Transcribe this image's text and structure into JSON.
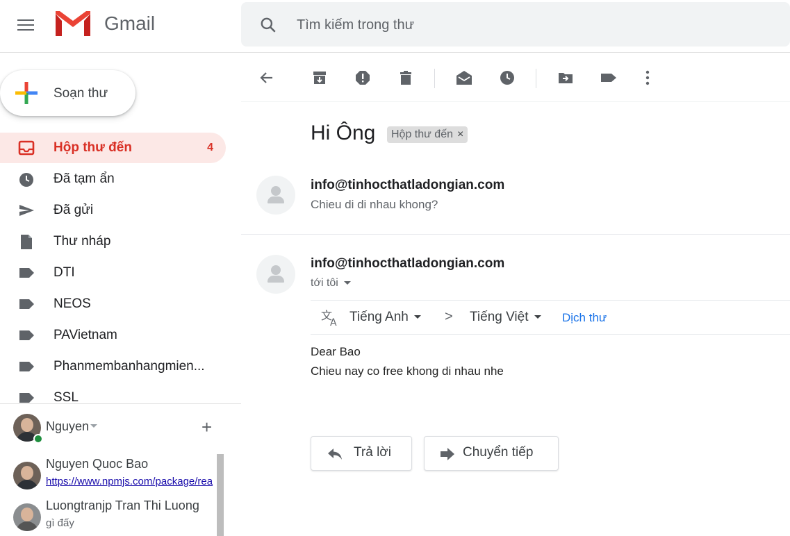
{
  "header": {
    "app_name": "Gmail",
    "search_placeholder": "Tìm kiếm trong thư"
  },
  "sidebar": {
    "compose_label": "Soạn thư",
    "items": [
      {
        "label": "Hộp thư đến",
        "count": "4",
        "icon": "inbox-icon",
        "active": true
      },
      {
        "label": "Đã tạm ẩn",
        "icon": "clock-icon"
      },
      {
        "label": "Đã gửi",
        "icon": "send-icon"
      },
      {
        "label": "Thư nháp",
        "icon": "draft-icon"
      },
      {
        "label": "DTI",
        "icon": "label-icon"
      },
      {
        "label": "NEOS",
        "icon": "label-icon"
      },
      {
        "label": "PAVietnam",
        "icon": "label-icon"
      },
      {
        "label": "Phanmembanhangmien...",
        "icon": "label-icon"
      },
      {
        "label": "SSL",
        "icon": "label-icon"
      }
    ],
    "hangouts": {
      "user_name": "Nguyen",
      "contacts": [
        {
          "name": "Nguyen Quoc Bao",
          "sub": "https://www.npmjs.com/package/rea"
        },
        {
          "name": "Luongtranjp Tran Thi Luong",
          "sub": "gì đấy"
        }
      ]
    }
  },
  "toolbar": {
    "icons": [
      "back-icon",
      "archive-icon",
      "report-spam-icon",
      "delete-icon",
      "mark-unread-icon",
      "snooze-icon",
      "move-to-icon",
      "labels-icon",
      "more-icon"
    ]
  },
  "thread": {
    "subject": "Hi Ông",
    "label_chip": "Hộp thư đến",
    "chip_close": "×",
    "messages": [
      {
        "sender": "info@tinhocthatladongian.com",
        "snippet": "Chieu di di nhau khong?"
      },
      {
        "sender": "info@tinhocthatladongian.com",
        "recipient": "tới tôi"
      }
    ],
    "translate": {
      "from_lang": "Tiếng Anh",
      "arrow": ">",
      "to_lang": "Tiếng Việt",
      "action": "Dịch thư"
    },
    "body": [
      "Dear Bao",
      "Chieu nay co free khong di nhau nhe"
    ],
    "reply_label": "Trả lời",
    "forward_label": "Chuyển tiếp"
  },
  "colors": {
    "accent": "#d93025",
    "active_bg": "#fce8e6",
    "link": "#1a73e8"
  }
}
